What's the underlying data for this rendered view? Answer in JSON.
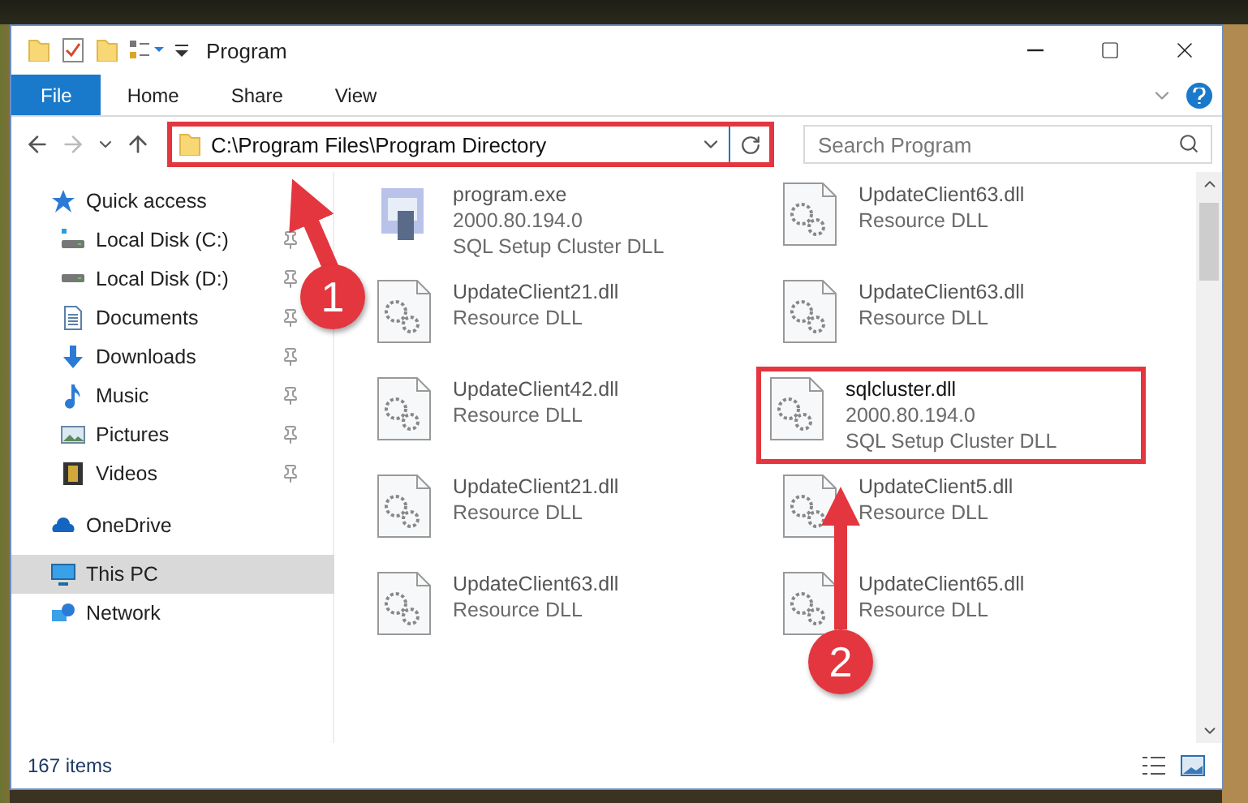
{
  "window": {
    "title": "Program"
  },
  "ribbon": {
    "tabs": [
      {
        "label": "File",
        "kind": "menu"
      },
      {
        "label": "Home",
        "kind": "tab"
      },
      {
        "label": "Share",
        "kind": "tab"
      },
      {
        "label": "View",
        "kind": "tab"
      }
    ]
  },
  "address": {
    "path": "C:\\Program Files\\Program Directory",
    "highlighted": true
  },
  "search": {
    "placeholder": "Search Program"
  },
  "sidebar": {
    "items": [
      {
        "label": "Quick access",
        "kind": "star",
        "selected": false,
        "children": [
          {
            "label": "Local Disk (C:)",
            "kind": "drive-c",
            "pinned": true,
            "selected": false
          },
          {
            "label": "Local Disk (D:)",
            "kind": "drive",
            "pinned": true,
            "selected": false
          },
          {
            "label": "Documents",
            "kind": "document",
            "pinned": true,
            "selected": false
          },
          {
            "label": "Downloads",
            "kind": "download",
            "pinned": true,
            "selected": false
          },
          {
            "label": "Music",
            "kind": "music",
            "pinned": true,
            "selected": false
          },
          {
            "label": "Pictures",
            "kind": "pictures",
            "pinned": true,
            "selected": false
          },
          {
            "label": "Videos",
            "kind": "videos",
            "pinned": true,
            "selected": false
          }
        ]
      },
      {
        "label": "OneDrive",
        "kind": "cloud",
        "selected": false
      },
      {
        "label": "This PC",
        "kind": "pc",
        "selected": true
      },
      {
        "label": "Network",
        "kind": "network",
        "selected": false
      }
    ]
  },
  "files": [
    {
      "name": "program.exe",
      "lines": [
        "2000.80.194.0",
        "SQL Setup Cluster DLL"
      ],
      "kind": "exe",
      "highlighted": false
    },
    {
      "name": "UpdateClient63.dll",
      "lines": [
        "Resource DLL"
      ],
      "kind": "dll",
      "highlighted": false
    },
    {
      "name": "UpdateClient21.dll",
      "lines": [
        "Resource DLL"
      ],
      "kind": "dll",
      "highlighted": false
    },
    {
      "name": "UpdateClient63.dll",
      "lines": [
        "Resource DLL"
      ],
      "kind": "dll",
      "highlighted": false
    },
    {
      "name": "UpdateClient42.dll",
      "lines": [
        "Resource DLL"
      ],
      "kind": "dll",
      "highlighted": false
    },
    {
      "name": "sqlcluster.dll",
      "lines": [
        "2000.80.194.0",
        "SQL Setup Cluster DLL"
      ],
      "kind": "dll",
      "highlighted": true
    },
    {
      "name": "UpdateClient21.dll",
      "lines": [
        "Resource DLL"
      ],
      "kind": "dll",
      "highlighted": false
    },
    {
      "name": "UpdateClient5.dll",
      "lines": [
        "Resource DLL"
      ],
      "kind": "dll",
      "highlighted": false
    },
    {
      "name": "UpdateClient63.dll",
      "lines": [
        "Resource DLL"
      ],
      "kind": "dll",
      "highlighted": false
    },
    {
      "name": "UpdateClient65.dll",
      "lines": [
        "Resource DLL"
      ],
      "kind": "dll",
      "highlighted": false
    }
  ],
  "status_bar": {
    "count": "167 items"
  },
  "annotations": [
    {
      "label": "1"
    },
    {
      "label": "2"
    }
  ]
}
